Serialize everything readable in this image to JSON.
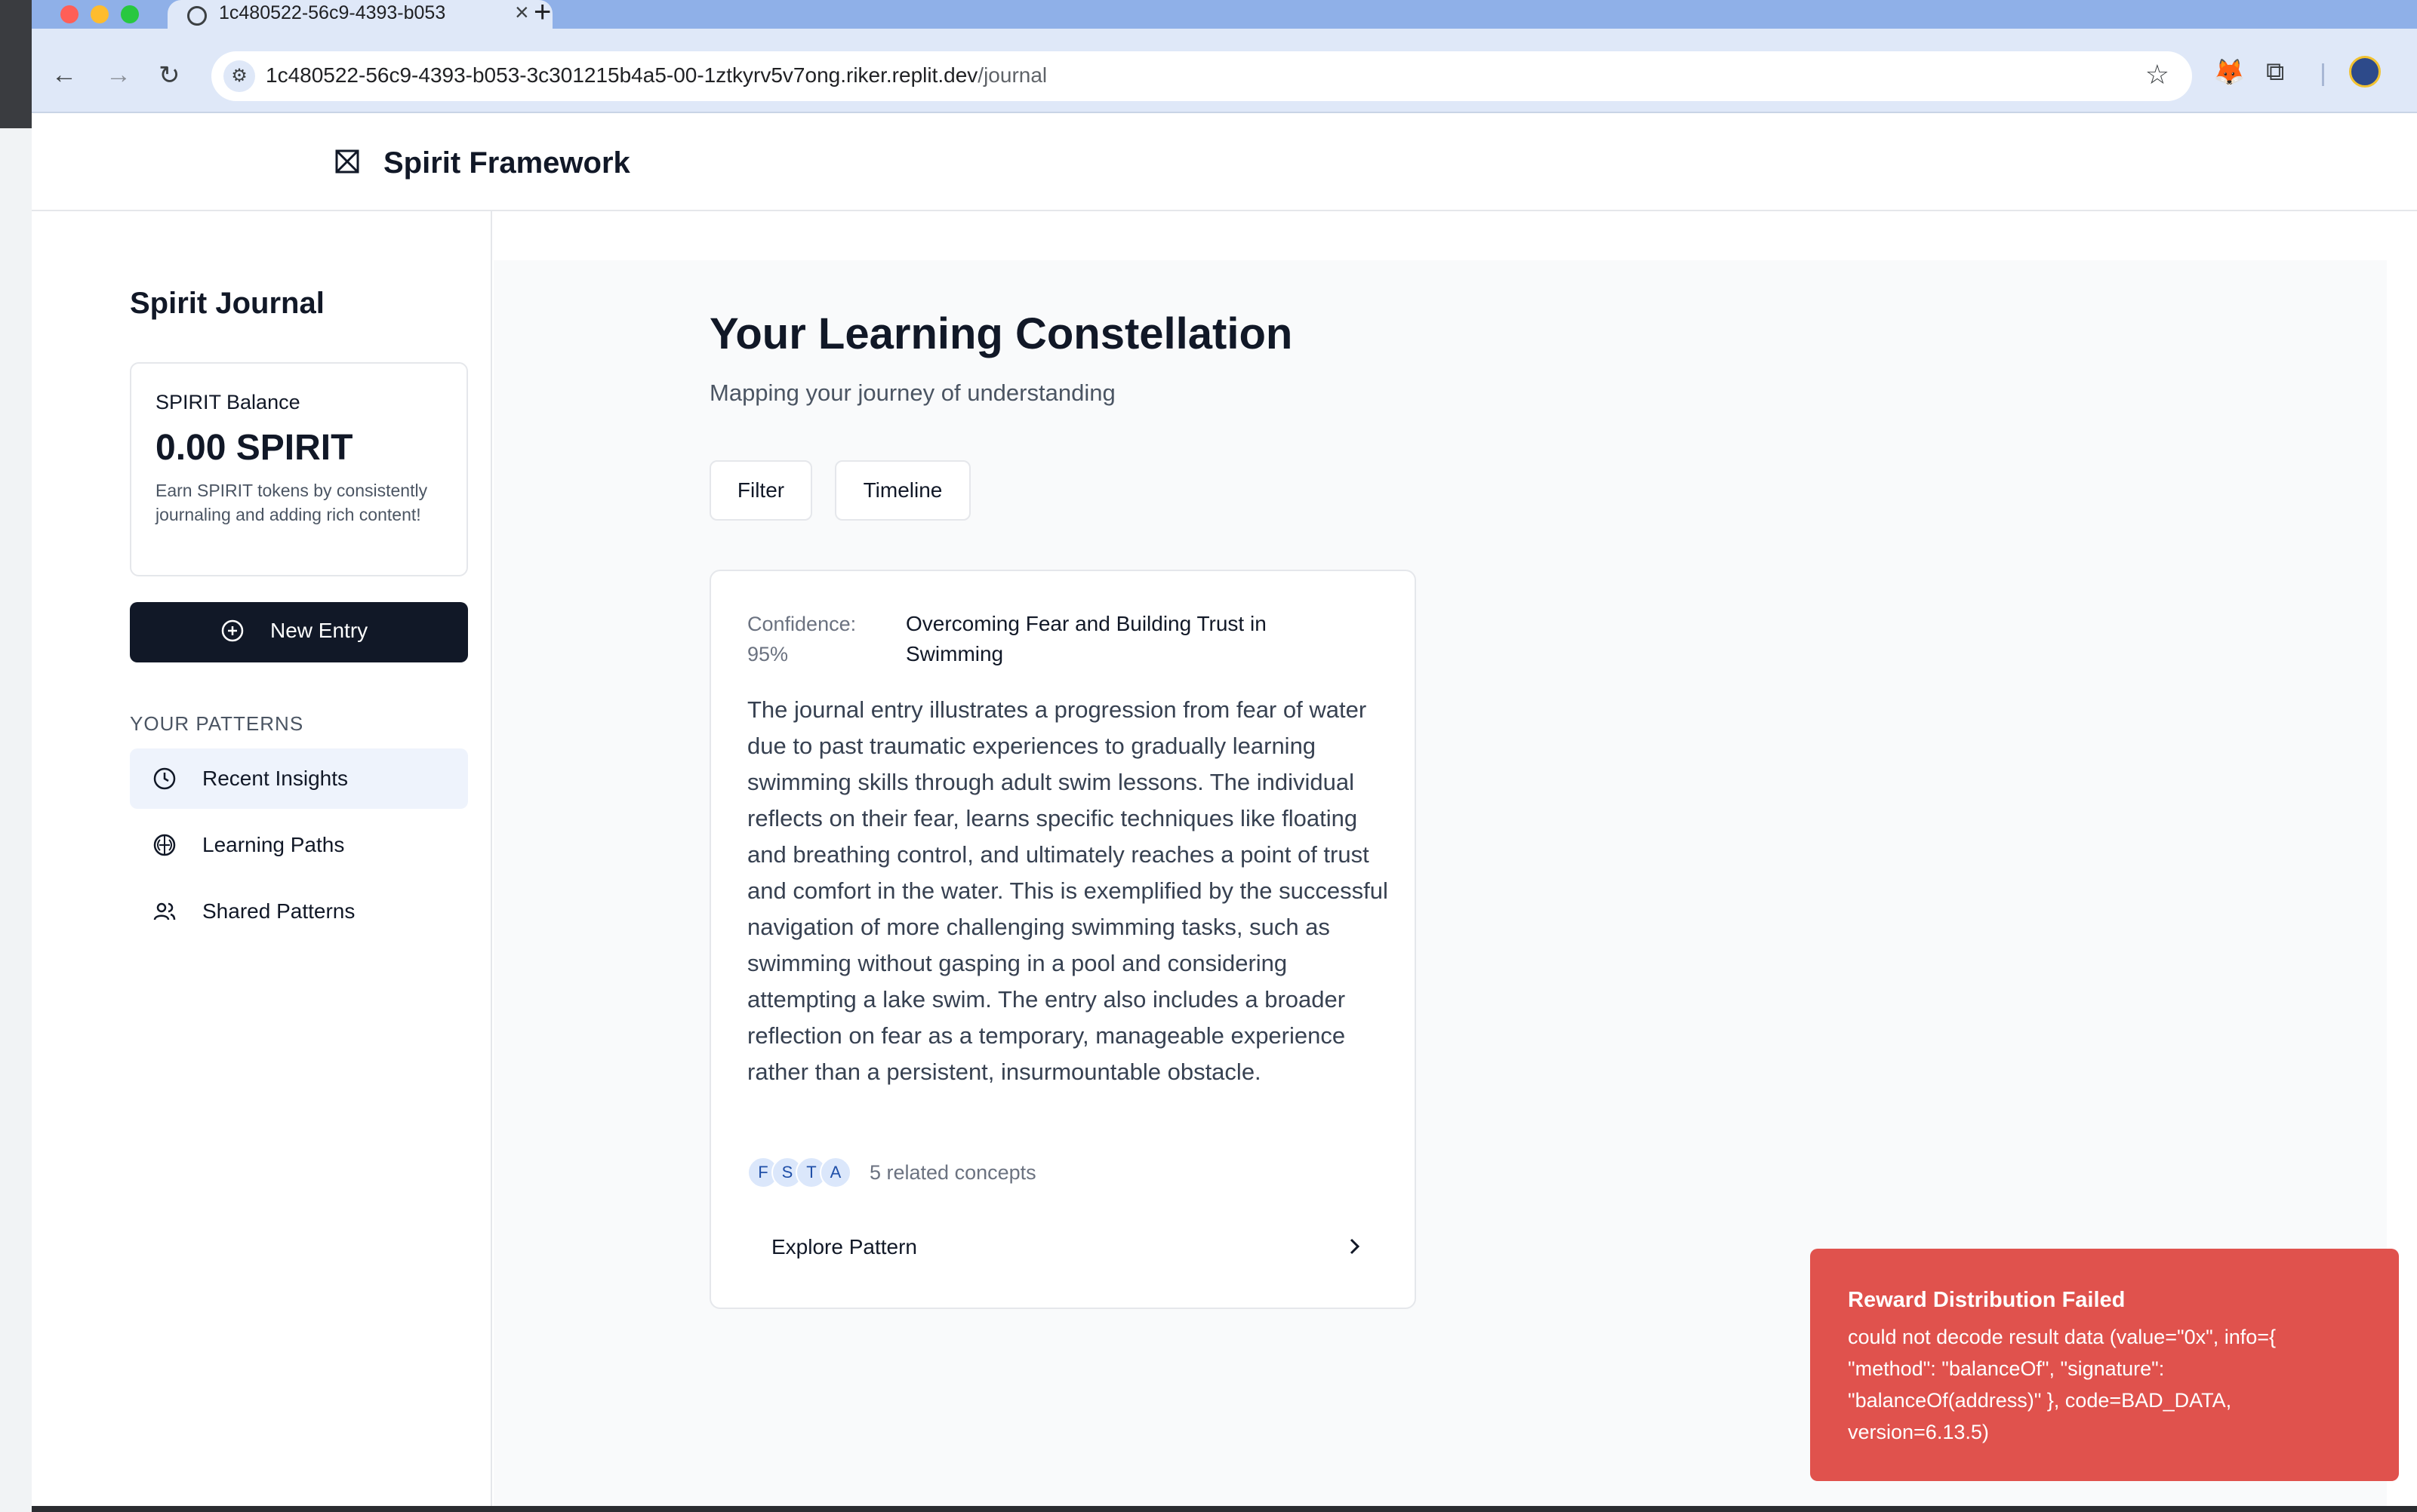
{
  "browser": {
    "tab_title": "1c480522-56c9-4393-b053",
    "url_host": "1c480522-56c9-4393-b053-3c301215b4a5-00-1ztkyrv5v7ong.riker.replit.dev",
    "url_path": "/journal"
  },
  "app": {
    "brand": "Spirit Framework"
  },
  "sidebar": {
    "title": "Spirit Journal",
    "balance": {
      "label": "SPIRIT Balance",
      "value": "0.00 SPIRIT",
      "description": "Earn SPIRIT tokens by consistently journaling and adding rich content!"
    },
    "new_entry_label": "New Entry",
    "patterns_heading": "YOUR PATTERNS",
    "items": [
      {
        "label": "Recent Insights",
        "icon": "clock-icon",
        "active": true
      },
      {
        "label": "Learning Paths",
        "icon": "brain-icon",
        "active": false
      },
      {
        "label": "Shared Patterns",
        "icon": "users-icon",
        "active": false
      }
    ]
  },
  "main": {
    "title": "Your Learning Constellation",
    "subtitle": "Mapping your journey of understanding",
    "filter_label": "Filter",
    "timeline_label": "Timeline",
    "card": {
      "confidence": "Confidence: 95%",
      "title": "Overcoming Fear and Building Trust in Swimming",
      "body": "The journal entry illustrates a progression from fear of water due to past traumatic experiences to gradually learning swimming skills through adult swim lessons. The individual reflects on their fear, learns specific techniques like floating and breathing control, and ultimately reaches a point of trust and comfort in the water. This is exemplified by the successful navigation of more challenging swimming tasks, such as swimming without gasping in a pool and considering attempting a lake swim. The entry also includes a broader reflection on fear as a temporary, manageable experience rather than a persistent, insurmountable obstacle.",
      "concepts": [
        "F",
        "S",
        "T",
        "A"
      ],
      "concepts_label": "5 related concepts",
      "explore_label": "Explore Pattern"
    }
  },
  "toast": {
    "title": "Reward Distribution Failed",
    "message": "could not decode result data (value=\"0x\", info={ \"method\": \"balanceOf\", \"signature\": \"balanceOf(address)\" }, code=BAD_DATA, version=6.13.5)",
    "color": "#e0524d"
  }
}
